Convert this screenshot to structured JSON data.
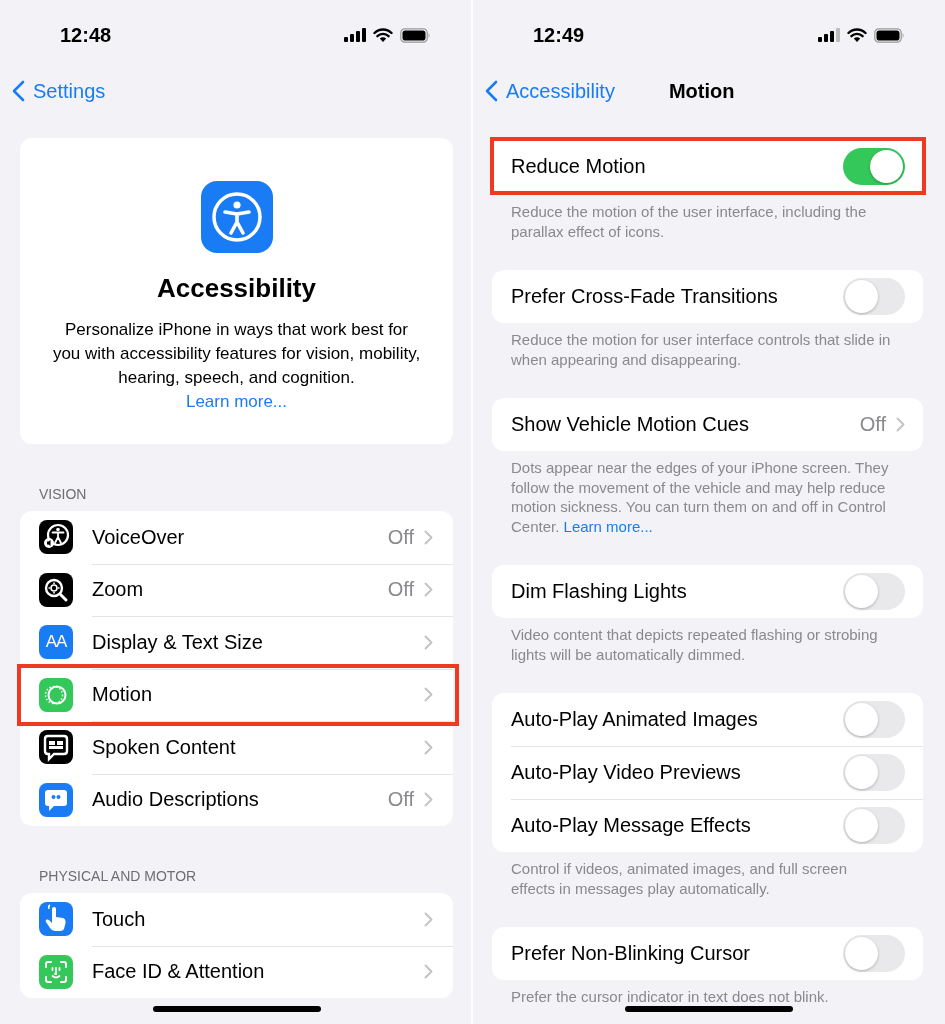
{
  "accessibility_screen": {
    "status_bar": {
      "time": "12:48"
    },
    "nav": {
      "back": "Settings"
    },
    "header_card": {
      "title": "Accessibility",
      "description": "Personalize iPhone in ways that work best for you with accessibility features for vision, mobility, hearing, speech, and cognition.",
      "link": "Learn more..."
    },
    "sections": [
      {
        "header": "VISION",
        "items": [
          {
            "label": "VoiceOver",
            "value": "Off",
            "color": "#000000",
            "highlighted": false
          },
          {
            "label": "Zoom",
            "value": "Off",
            "color": "#000000",
            "highlighted": false
          },
          {
            "label": "Display & Text Size",
            "icon_text": "AA",
            "color": "#1a7cf5",
            "highlighted": false
          },
          {
            "label": "Motion",
            "color": "#34c759",
            "highlighted": true
          },
          {
            "label": "Spoken Content",
            "color": "#000000",
            "highlighted": false
          },
          {
            "label": "Audio Descriptions",
            "value": "Off",
            "color": "#1a7cf5",
            "highlighted": false
          }
        ]
      },
      {
        "header": "PHYSICAL AND MOTOR",
        "items": [
          {
            "label": "Touch",
            "color": "#1a7cf5",
            "highlighted": false
          },
          {
            "label": "Face ID & Attention",
            "color": "#34c759",
            "highlighted": false
          }
        ]
      }
    ]
  },
  "motion_screen": {
    "status_bar": {
      "time": "12:49"
    },
    "nav": {
      "back": "Accessibility",
      "title": "Motion"
    },
    "groups": [
      {
        "rows": [
          {
            "kind": "toggle",
            "label": "Reduce Motion",
            "on": true,
            "highlighted": true
          }
        ],
        "footer": "Reduce the motion of the user interface, including the parallax effect of icons."
      },
      {
        "rows": [
          {
            "kind": "toggle",
            "label": "Prefer Cross-Fade Transitions",
            "on": false,
            "highlighted": false
          }
        ],
        "footer": "Reduce the motion for user interface controls that slide in when appearing and disappearing."
      },
      {
        "rows": [
          {
            "kind": "disclosure",
            "label": "Show Vehicle Motion Cues",
            "value": "Off",
            "highlighted": false
          }
        ],
        "footer": "Dots appear near the edges of your iPhone screen. They follow the movement of the vehicle and may help reduce motion sickness. You can turn them on and off in Control Center.",
        "footer_link": "Learn more..."
      },
      {
        "rows": [
          {
            "kind": "toggle",
            "label": "Dim Flashing Lights",
            "on": false,
            "highlighted": false
          }
        ],
        "footer": "Video content that depicts repeated flashing or strobing lights will be automatically dimmed."
      },
      {
        "rows": [
          {
            "kind": "toggle",
            "label": "Auto-Play Animated Images",
            "on": false,
            "highlighted": false
          },
          {
            "kind": "toggle",
            "label": "Auto-Play Video Previews",
            "on": false,
            "highlighted": false
          },
          {
            "kind": "toggle",
            "label": "Auto-Play Message Effects",
            "on": false,
            "highlighted": false
          }
        ],
        "footer": "Control if videos, animated images, and full screen effects in messages play automatically."
      },
      {
        "rows": [
          {
            "kind": "toggle",
            "label": "Prefer Non-Blinking Cursor",
            "on": false,
            "highlighted": false
          }
        ],
        "footer": "Prefer the cursor indicator in text does not blink."
      }
    ]
  }
}
